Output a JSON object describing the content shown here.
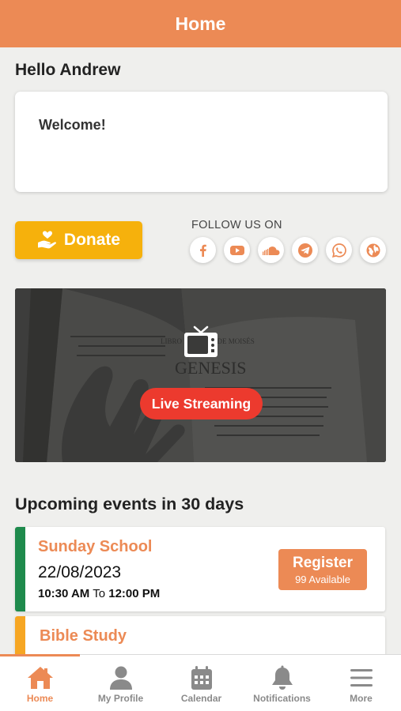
{
  "header": {
    "title": "Home"
  },
  "greeting": "Hello Andrew",
  "welcome_card": {
    "text": "Welcome!"
  },
  "donate": {
    "label": "Donate"
  },
  "follow": {
    "label": "FOLLOW US ON",
    "icons": [
      "facebook-icon",
      "youtube-icon",
      "soundcloud-icon",
      "telegram-icon",
      "whatsapp-icon",
      "globe-icon"
    ]
  },
  "live": {
    "label": "Live Streaming"
  },
  "events": {
    "title": "Upcoming events in 30 days",
    "items": [
      {
        "name": "Sunday School",
        "date": "22/08/2023",
        "start": "10:30 AM",
        "to": "To",
        "end": "12:00 PM",
        "button": "Register",
        "availability": "99 Available",
        "stripe_color": "#1e8a4c"
      },
      {
        "name": "Bible Study",
        "stripe_color": "#f6a623"
      }
    ]
  },
  "tabs": [
    {
      "label": "Home",
      "icon": "home-icon",
      "active": true
    },
    {
      "label": "My Profile",
      "icon": "user-icon",
      "active": false
    },
    {
      "label": "Calendar",
      "icon": "calendar-icon",
      "active": false
    },
    {
      "label": "Notifications",
      "icon": "bell-icon",
      "active": false
    },
    {
      "label": "More",
      "icon": "menu-icon",
      "active": false
    }
  ],
  "colors": {
    "accent": "#ec8a55",
    "donate": "#f6b10c",
    "live": "#ec3a2e",
    "inactive": "#8a8a8a"
  }
}
